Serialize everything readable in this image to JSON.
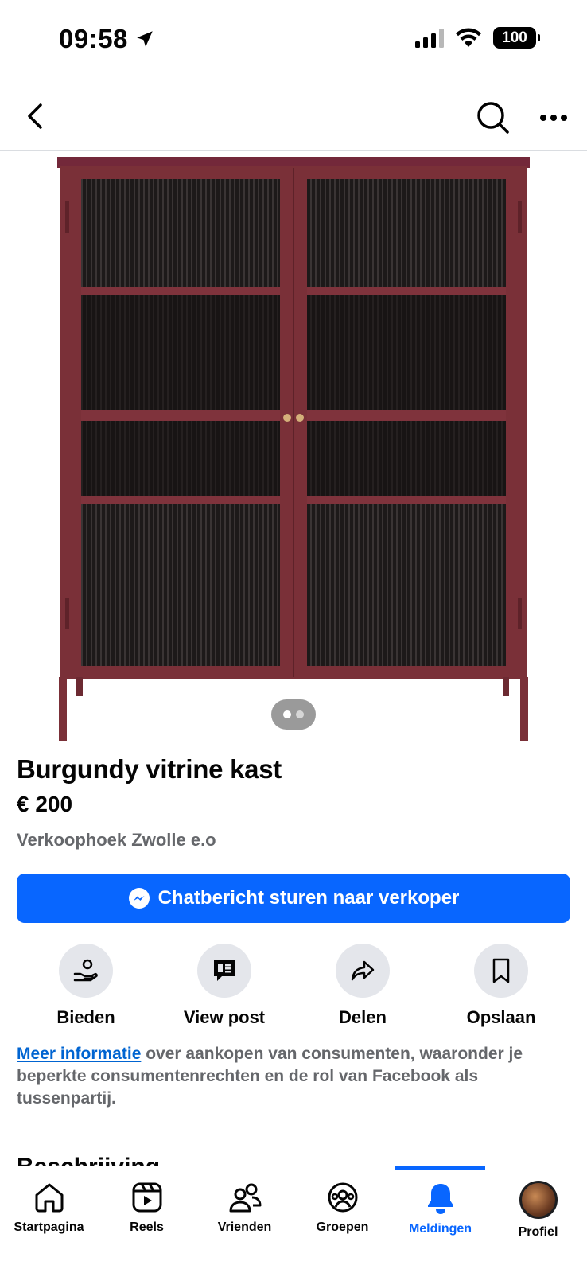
{
  "status_bar": {
    "time": "09:58",
    "battery": "100"
  },
  "product": {
    "title": "Burgundy vitrine kast",
    "price": "€ 200",
    "group": "Verkoophoek Zwolle e.o",
    "image_count": 2,
    "image_index": 1,
    "colors": {
      "cabinet": "#7a3038",
      "glass": "#1a1616"
    }
  },
  "chat_button": {
    "label": "Chatbericht sturen naar verkoper"
  },
  "actions": [
    {
      "label": "Bieden",
      "icon": "offer-hand-icon"
    },
    {
      "label": "View post",
      "icon": "post-icon"
    },
    {
      "label": "Delen",
      "icon": "share-icon"
    },
    {
      "label": "Opslaan",
      "icon": "bookmark-icon"
    }
  ],
  "info": {
    "link": "Meer informatie",
    "text": " over aankopen van consumenten, waaronder je beperkte consumentenrechten en de rol van Facebook als tussenpartij."
  },
  "section_heading": "Beschrijving",
  "tabs": [
    {
      "label": "Startpagina",
      "icon": "home-icon",
      "active": false
    },
    {
      "label": "Reels",
      "icon": "reels-icon",
      "active": false
    },
    {
      "label": "Vrienden",
      "icon": "friends-icon",
      "active": false
    },
    {
      "label": "Groepen",
      "icon": "groups-icon",
      "active": false
    },
    {
      "label": "Meldingen",
      "icon": "bell-icon",
      "active": true
    },
    {
      "label": "Profiel",
      "icon": "avatar",
      "active": false
    }
  ],
  "colors": {
    "accent": "#0866ff",
    "link": "#0064d1",
    "secondary_text": "#65676b"
  }
}
